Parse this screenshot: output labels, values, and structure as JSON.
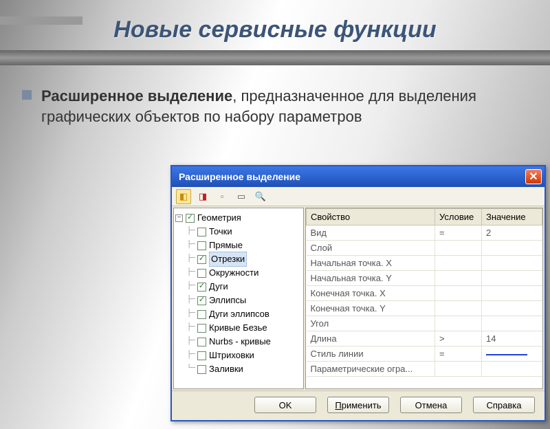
{
  "slide": {
    "title": "Новые сервисные функции",
    "lead": "Расширенное выделение",
    "rest": ", предназначенное для выделения графических объектов по набору параметров"
  },
  "dialog": {
    "title": "Расширенное выделение",
    "close_icon": "✕",
    "toolbar": {
      "b1": "⬚",
      "b2": "⬚",
      "b3": "⬚",
      "b4": "▭",
      "b5": "🔍"
    },
    "tree": {
      "root": "Геометрия",
      "items": [
        {
          "label": "Точки",
          "checked": false,
          "selected": false
        },
        {
          "label": "Прямые",
          "checked": false,
          "selected": false
        },
        {
          "label": "Отрезки",
          "checked": true,
          "selected": true
        },
        {
          "label": "Окружности",
          "checked": false,
          "selected": false
        },
        {
          "label": "Дуги",
          "checked": true,
          "selected": false
        },
        {
          "label": "Эллипсы",
          "checked": true,
          "selected": false
        },
        {
          "label": "Дуги эллипсов",
          "checked": false,
          "selected": false
        },
        {
          "label": "Кривые Безье",
          "checked": false,
          "selected": false
        },
        {
          "label": "Nurbs - кривые",
          "checked": false,
          "selected": false
        },
        {
          "label": "Штриховки",
          "checked": false,
          "selected": false
        },
        {
          "label": "Заливки",
          "checked": false,
          "selected": false
        }
      ]
    },
    "grid": {
      "headers": {
        "prop": "Свойство",
        "cond": "Условие",
        "val": "Значение"
      },
      "rows": [
        {
          "prop": "Вид",
          "cond": "=",
          "val": "2"
        },
        {
          "prop": "Слой",
          "cond": "",
          "val": ""
        },
        {
          "prop": "Начальная точка. X",
          "cond": "",
          "val": ""
        },
        {
          "prop": "Начальная точка. Y",
          "cond": "",
          "val": ""
        },
        {
          "prop": "Конечная точка. X",
          "cond": "",
          "val": ""
        },
        {
          "prop": "Конечная точка. Y",
          "cond": "",
          "val": ""
        },
        {
          "prop": "Угол",
          "cond": "",
          "val": ""
        },
        {
          "prop": "Длина",
          "cond": ">",
          "val": "14"
        },
        {
          "prop": "Стиль линии",
          "cond": "=",
          "val": "__line__"
        },
        {
          "prop": "Параметрические огра...",
          "cond": "",
          "val": ""
        }
      ]
    },
    "buttons": {
      "ok": "OK",
      "apply": "Применить",
      "cancel": "Отмена",
      "help": "Справка"
    }
  }
}
